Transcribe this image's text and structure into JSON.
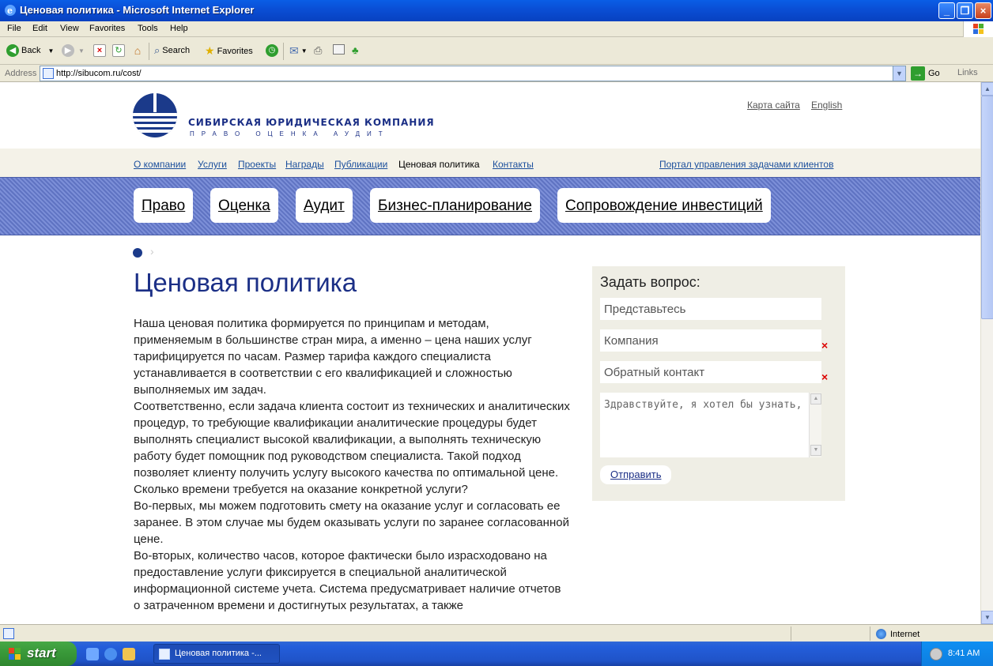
{
  "window": {
    "title": "Ценовая политика - Microsoft Internet Explorer"
  },
  "menu": [
    "File",
    "Edit",
    "View",
    "Favorites",
    "Tools",
    "Help"
  ],
  "toolbar": {
    "back": "Back",
    "search": "Search",
    "favorites": "Favorites"
  },
  "address": {
    "label": "Address",
    "url": "http://sibucom.ru/cost/",
    "go": "Go",
    "links": "Links"
  },
  "site": {
    "logo_name": "СИБИРСКАЯ ЮРИДИЧЕСКАЯ КОМПАНИЯ",
    "logo_sub": "ПРАВО ОЦЕНКА АУДИТ",
    "sitemap": "Карта сайта",
    "english": "English",
    "nav": [
      "О компании",
      "Услуги",
      "Проекты",
      "Награды",
      "Публикации",
      "Ценовая политика",
      "Контакты"
    ],
    "portal": "Портал управления задачами клиентов",
    "tabs": [
      "Право",
      "Оценка",
      "Аудит",
      "Бизнес-планирование",
      "Сопровождение инвестиций"
    ],
    "page_title": "Ценовая политика",
    "paragraphs": [
      "Наша ценовая политика формируется по принципам и методам, применяемым в большинстве стран мира, а именно – цена наших услуг тарифицируется по часам. Размер тарифа каждого специалиста устанавливается в соответствии с его квалификацией и сложностью выполняемых им задач.",
      "Соответственно, если задача клиента состоит из технических и аналитических процедур, то требующие квалификации аналитические процедуры будет выполнять специалист высокой квалификации, а выполнять техническую работу будет помощник под руководством специалиста. Такой подход позволяет клиенту получить услугу высокого качества по оптимальной цене.",
      "Сколько времени требуется на оказание конкретной услуги?",
      "Во-первых, мы можем подготовить смету на оказание услуг и согласовать ее заранее. В этом случае мы будем оказывать услуги по заранее согласованной цене.",
      "Во-вторых, количество часов, которое фактически было израсходовано на предоставление услуги фиксируется в специальной аналитической информационной системе учета. Система предусматривает наличие отчетов о затраченном времени и достигнутых результатах, а также"
    ]
  },
  "question_form": {
    "title": "Задать вопрос:",
    "name_placeholder": "Представьтесь",
    "company_placeholder": "Компания",
    "contact_placeholder": "Обратный контакт",
    "required_mark": "×",
    "message": "Здравствуйте, я хотел бы узнать,",
    "submit": "Отправить"
  },
  "statusbar": {
    "zone": "Internet"
  },
  "taskbar": {
    "start": "start",
    "window_item": "Ценовая политика -...",
    "clock": "8:41 AM"
  },
  "colors": {
    "brand_blue": "#1b2f86",
    "link_blue": "#1b4f9c",
    "required_red": "#dd0000"
  }
}
